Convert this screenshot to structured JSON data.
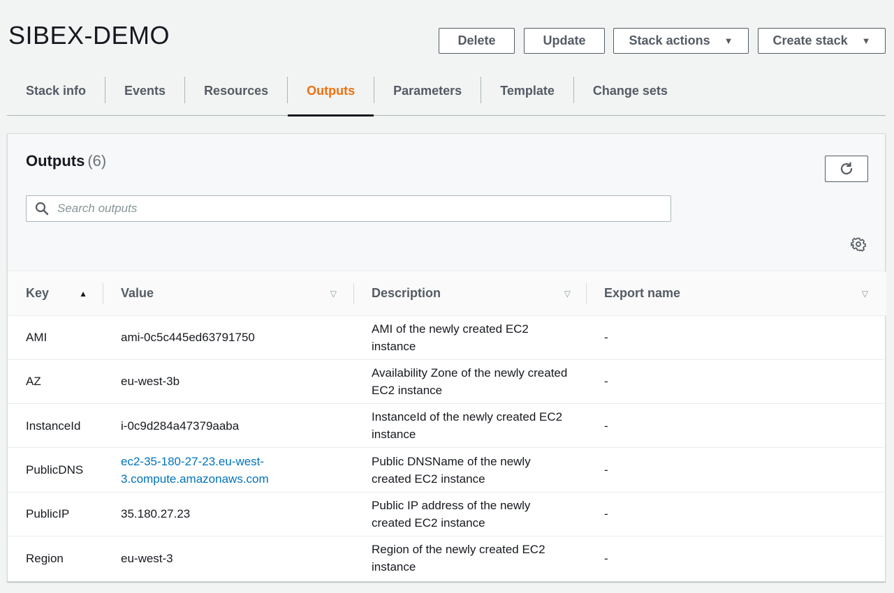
{
  "header": {
    "title": "SIBEX-DEMO",
    "buttons": {
      "delete": "Delete",
      "update": "Update",
      "stack_actions": "Stack actions",
      "create_stack": "Create stack"
    }
  },
  "tabs": [
    "Stack info",
    "Events",
    "Resources",
    "Outputs",
    "Parameters",
    "Template",
    "Change sets"
  ],
  "active_tab": "Outputs",
  "outputs": {
    "title": "Outputs",
    "count": "(6)",
    "search_placeholder": "Search outputs",
    "columns": [
      "Key",
      "Value",
      "Description",
      "Export name"
    ],
    "rows": [
      {
        "key": "AMI",
        "value": "ami-0c5c445ed63791750",
        "description": "AMI of the newly created EC2 instance",
        "export": "-"
      },
      {
        "key": "AZ",
        "value": "eu-west-3b",
        "description": "Availability Zone of the newly created EC2 instance",
        "export": "-"
      },
      {
        "key": "InstanceId",
        "value": "i-0c9d284a47379aaba",
        "description": "InstanceId of the newly created EC2 instance",
        "export": "-"
      },
      {
        "key": "PublicDNS",
        "value": "ec2-35-180-27-23.eu-west-3.compute.amazonaws.com",
        "description": "Public DNSName of the newly created EC2 instance",
        "export": "-"
      },
      {
        "key": "PublicIP",
        "value": "35.180.27.23",
        "description": "Public IP address of the newly created EC2 instance",
        "export": "-"
      },
      {
        "key": "Region",
        "value": "eu-west-3",
        "description": "Region of the newly created EC2 instance",
        "export": "-"
      }
    ]
  },
  "colors": {
    "active_tab": "#ec7211",
    "link": "#0073bb",
    "button_border": "#545b64"
  },
  "icons": [
    "caret-down-icon",
    "refresh-icon",
    "search-icon",
    "gear-icon",
    "sort-ascending-icon",
    "sort-icon"
  ]
}
